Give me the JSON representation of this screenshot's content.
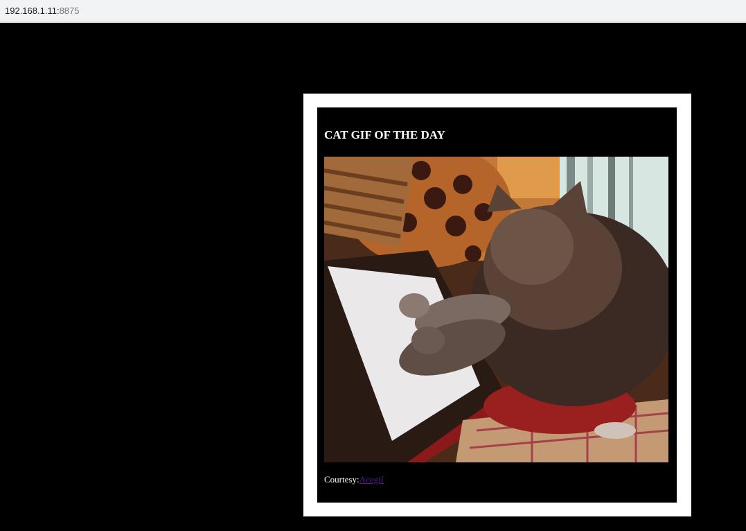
{
  "browser": {
    "url_host": "192.168.1.11:",
    "url_port": "8875"
  },
  "card": {
    "title": "CAT GIF OF THE DAY",
    "courtesy_label": "Courtesy:",
    "courtesy_link": "Acegif"
  },
  "colors": {
    "page_background": "#000000",
    "card_frame": "#ffffff",
    "visited_link": "#551a8b"
  }
}
